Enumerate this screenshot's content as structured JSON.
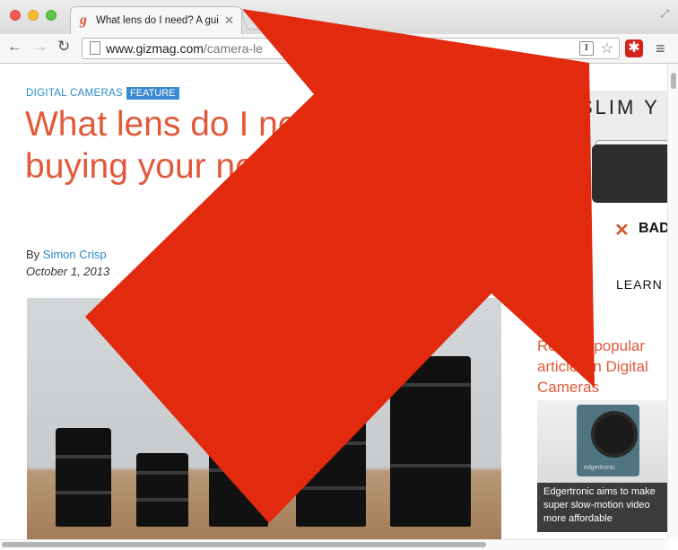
{
  "browser": {
    "tab_title": "What lens do I need? A gui",
    "tab_favicon": "g",
    "url_host": "www.gizmag.com",
    "url_path": "/camera-le",
    "reader_label": "I"
  },
  "article": {
    "category": "DIGITAL CAMERAS",
    "badge": "FEATURE",
    "headline": "What lens do I need? A guide to buying your next camera lens",
    "byline_prefix": "By",
    "author": "Simon Crisp",
    "date": "October 1, 2013"
  },
  "ad": {
    "headline": "SLIM Y",
    "bad_text": "BAD",
    "cta": "LEARN"
  },
  "sidebar": {
    "related_title": "Related popular articles in Digital Cameras",
    "card_caption": "Edgertronic aims to make super slow-motion video more affordable",
    "card_logo": "edgertronic"
  },
  "overlay": {
    "arrow_color": "#e12a0e"
  }
}
